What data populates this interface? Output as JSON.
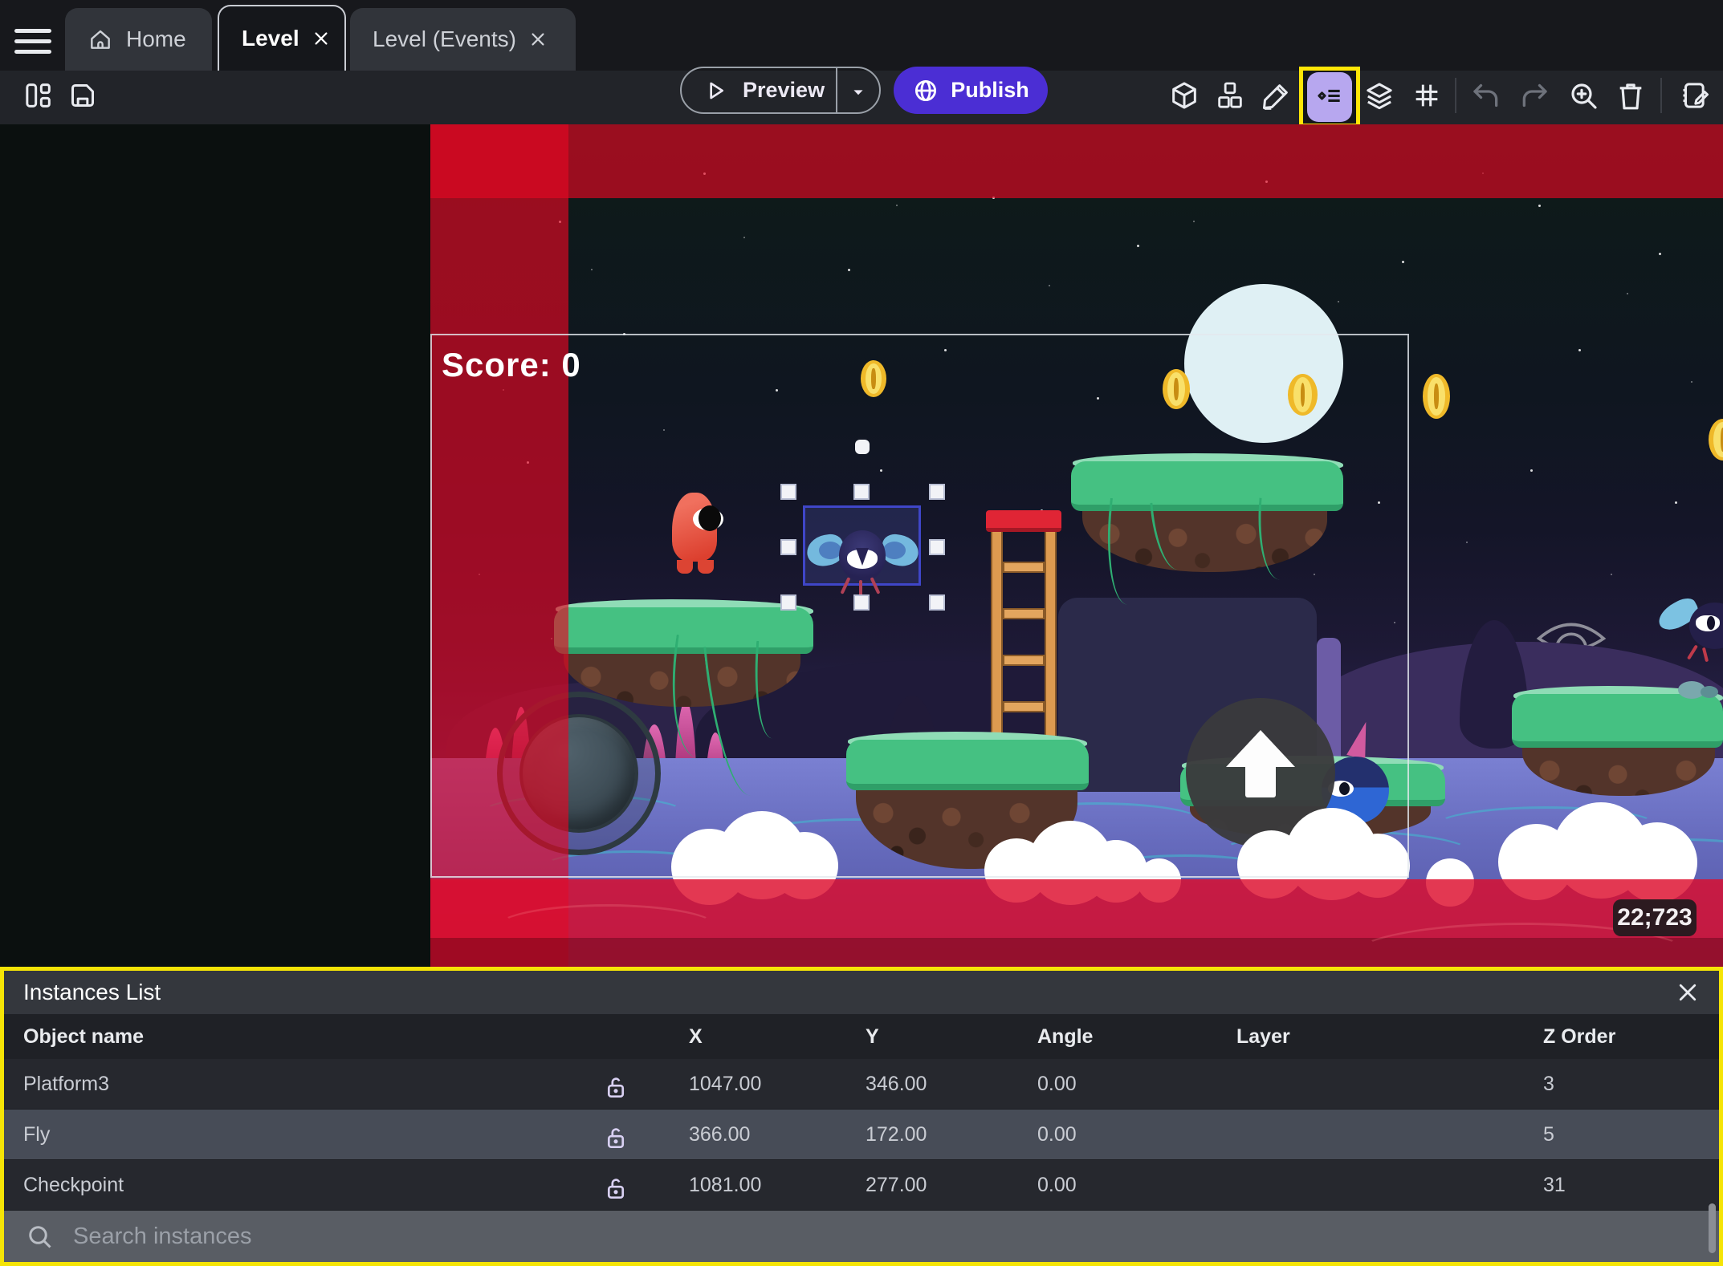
{
  "window": {
    "tabs": [
      {
        "label": "Home"
      },
      {
        "label": "Level",
        "active": true,
        "closable": true
      },
      {
        "label": "Level (Events)",
        "closable": true
      }
    ]
  },
  "toolbar": {
    "preview_label": "Preview",
    "publish_label": "Publish"
  },
  "game": {
    "score_text": "Score: 0",
    "coordinates_badge": "22;723",
    "selected_instance": "Fly"
  },
  "instances_panel": {
    "title": "Instances List",
    "columns": {
      "object_name": "Object name",
      "x": "X",
      "y": "Y",
      "angle": "Angle",
      "layer": "Layer",
      "z_order": "Z Order"
    },
    "rows": [
      {
        "object_name": "Platform3",
        "x": "1047.00",
        "y": "346.00",
        "angle": "0.00",
        "layer": "",
        "z_order": "3"
      },
      {
        "object_name": "Fly",
        "x": "366.00",
        "y": "172.00",
        "angle": "0.00",
        "layer": "",
        "z_order": "5",
        "selected": true
      },
      {
        "object_name": "Checkpoint",
        "x": "1081.00",
        "y": "277.00",
        "angle": "0.00",
        "layer": "",
        "z_order": "31"
      }
    ],
    "search_placeholder": "Search instances"
  },
  "colors": {
    "publish_button": "#4b2ed4",
    "highlight_yellow": "#ffe606",
    "active_icon_lavender": "#b7a7ef",
    "out_of_bounds_red": "#e30823",
    "selection_blue": "#3f46c8",
    "selected_row": "#474c57"
  }
}
